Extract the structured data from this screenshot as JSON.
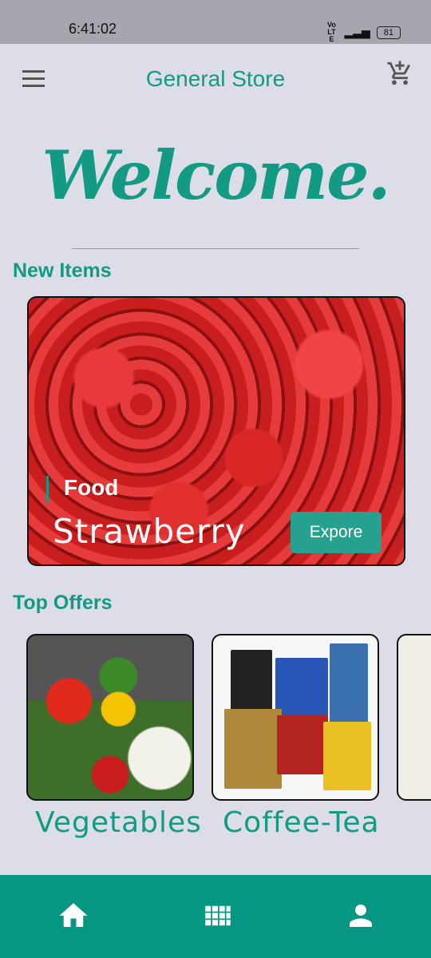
{
  "status": {
    "time": "6:41:02",
    "network": "VoLTE",
    "battery": "81"
  },
  "appbar": {
    "title": "General Store"
  },
  "welcome": "Welcome.",
  "new_items": {
    "heading": "New Items",
    "hero": {
      "category": "Food",
      "name": "Strawberry",
      "button": "Expore"
    }
  },
  "top_offers": {
    "heading": "Top Offers",
    "items": [
      {
        "label": "Vegetables"
      },
      {
        "label": "Coffee-Tea"
      }
    ]
  },
  "bottom_nav": {
    "items": [
      "home-icon",
      "grid-icon",
      "person-icon"
    ]
  },
  "colors": {
    "accent": "#139a84",
    "nav": "#059784",
    "background": "#dcdde6"
  }
}
